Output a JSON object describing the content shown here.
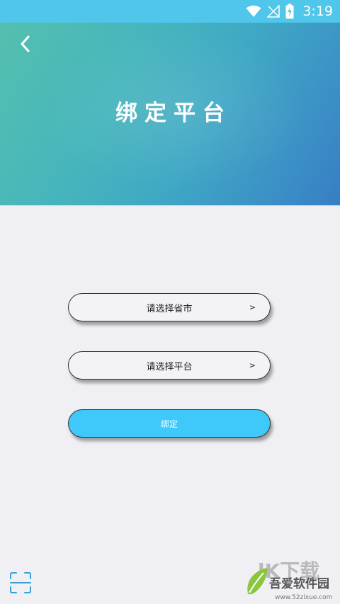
{
  "status_bar": {
    "time": "3:19",
    "icons": [
      "wifi-icon",
      "no-signal-icon",
      "battery-charging-icon"
    ]
  },
  "header": {
    "back_icon": "chevron-left-icon",
    "title": "绑定平台"
  },
  "form": {
    "province_label": "请选择省市",
    "province_arrow": ">",
    "platform_label": "请选择平台",
    "platform_arrow": ">",
    "bind_label": "绑定"
  },
  "footer": {
    "scan_icon": "scan-icon"
  },
  "watermark": {
    "big_text": "lK下载",
    "name": "吾爱软件园",
    "url": "www.52zixue.com"
  },
  "colors": {
    "status_bar": "#4fc6ea",
    "header_gradient_start": "#56c0ad",
    "header_gradient_end": "#377ec4",
    "background": "#efeff4",
    "bind_button": "#3fc9fa",
    "scan_icon": "#3aa0d8"
  }
}
